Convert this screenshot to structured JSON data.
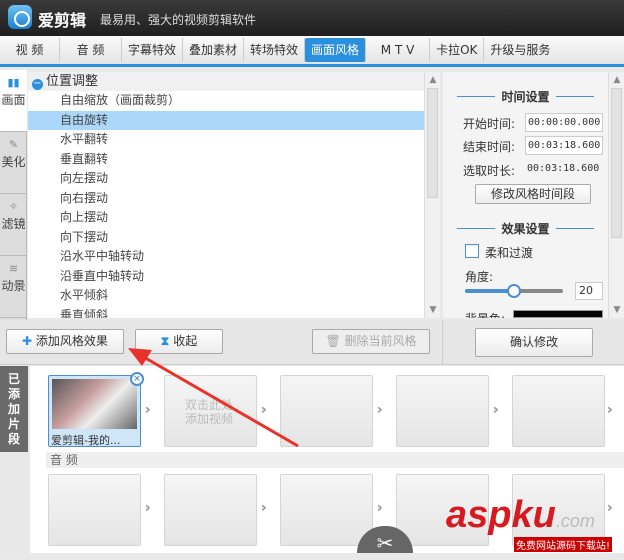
{
  "title": {
    "app_name": "爱剪辑",
    "slogan": "最易用、强大的视频剪辑软件"
  },
  "tabs": [
    {
      "label": "视 频"
    },
    {
      "label": "音 频"
    },
    {
      "label": "字幕特效"
    },
    {
      "label": "叠加素材"
    },
    {
      "label": "转场特效"
    },
    {
      "label": "画面风格",
      "active": true
    },
    {
      "label": "M T V"
    },
    {
      "label": "卡拉OK"
    },
    {
      "label": "升级与服务"
    }
  ],
  "side_tabs": [
    {
      "label": "画面",
      "icon": "screen-icon"
    },
    {
      "label": "美化",
      "icon": "wand-icon"
    },
    {
      "label": "滤镜",
      "icon": "sparkle-icon"
    },
    {
      "label": "动景",
      "icon": "wave-icon"
    }
  ],
  "style_list": {
    "group": "位置调整",
    "items": [
      "自由缩放（画面裁剪）",
      "自由旋转",
      "水平翻转",
      "垂直翻转",
      "向左摆动",
      "向右摆动",
      "向上摆动",
      "向下摆动",
      "沿水平中轴转动",
      "沿垂直中轴转动",
      "水平倾斜",
      "垂直倾斜"
    ],
    "selected": "自由旋转"
  },
  "time_settings": {
    "heading": "时间设置",
    "start_label": "开始时间:",
    "start_value": "00:00:00.000",
    "end_label": "结束时间:",
    "end_value": "00:03:18.600",
    "duration_label": "选取时长:",
    "duration_value": "00:03:18.600",
    "modify_button": "修改风格时间段"
  },
  "effect_settings": {
    "heading": "效果设置",
    "smooth_label": "柔和过渡",
    "smooth_checked": false,
    "angle_label": "角度:",
    "angle_value": "20",
    "angle_fraction": 0.5,
    "bg_label": "背景色:",
    "bg_color": "#000000"
  },
  "buttons": {
    "add": "添加风格效果",
    "collapse": "收起",
    "delete": "删除当前风格",
    "confirm": "确认修改"
  },
  "timeline": {
    "tab_label": "已添加片段",
    "clip_title": "爱剪辑-我的...",
    "empty_hint": "双击此处添加视频",
    "audio_label": "音 频"
  },
  "watermark": {
    "brand": "aspku",
    "suffix": ".com",
    "subtitle": "免费网站源码下载站!"
  }
}
